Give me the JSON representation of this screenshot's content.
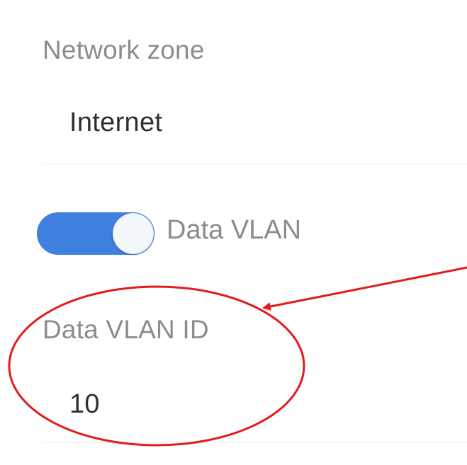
{
  "network_zone": {
    "label": "Network zone",
    "value": "Internet"
  },
  "data_vlan_toggle": {
    "label": "Data VLAN",
    "state": "on",
    "accent_color": "#3f7fde"
  },
  "data_vlan_id": {
    "label": "Data VLAN ID",
    "value": "10"
  },
  "annotation": {
    "color": "#e31b1b"
  }
}
